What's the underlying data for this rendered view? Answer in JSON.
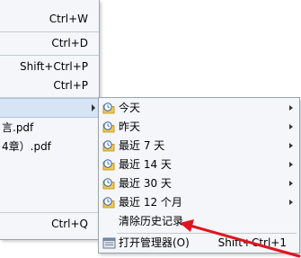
{
  "file_menu": {
    "items": [
      {
        "label": "",
        "shortcut": "Ctrl+W"
      },
      {
        "label": "",
        "shortcut": "Ctrl+D"
      },
      {
        "label": "",
        "shortcut": "Shift+Ctrl+P"
      },
      {
        "label": "",
        "shortcut": "Ctrl+P"
      },
      {
        "label": "",
        "shortcut": ""
      },
      {
        "label": "言.pdf",
        "shortcut": ""
      },
      {
        "label": "4章）.pdf",
        "shortcut": ""
      },
      {
        "label": "",
        "shortcut": "Ctrl+Q"
      }
    ]
  },
  "history_submenu": {
    "items": [
      {
        "label": "今天",
        "icon": "folder-clock-icon",
        "has_submenu": true
      },
      {
        "label": "昨天",
        "icon": "folder-clock-icon",
        "has_submenu": true
      },
      {
        "label": "最近 7 天",
        "icon": "folder-clock-icon",
        "has_submenu": true
      },
      {
        "label": "最近 14 天",
        "icon": "folder-clock-icon",
        "has_submenu": true
      },
      {
        "label": "最近 30 天",
        "icon": "folder-clock-icon",
        "has_submenu": true
      },
      {
        "label": "最近 12 个月",
        "icon": "folder-clock-icon",
        "has_submenu": true
      }
    ],
    "clear_history": "清除历史记录",
    "open_manager": {
      "label": "打开管理器(O)",
      "shortcut": "Shift+Ctrl+1",
      "icon": "manager-icon"
    }
  },
  "colors": {
    "menu_bg": "#f4f6f9",
    "highlight": "#d7e4f4",
    "annotation": "#e0141e"
  }
}
